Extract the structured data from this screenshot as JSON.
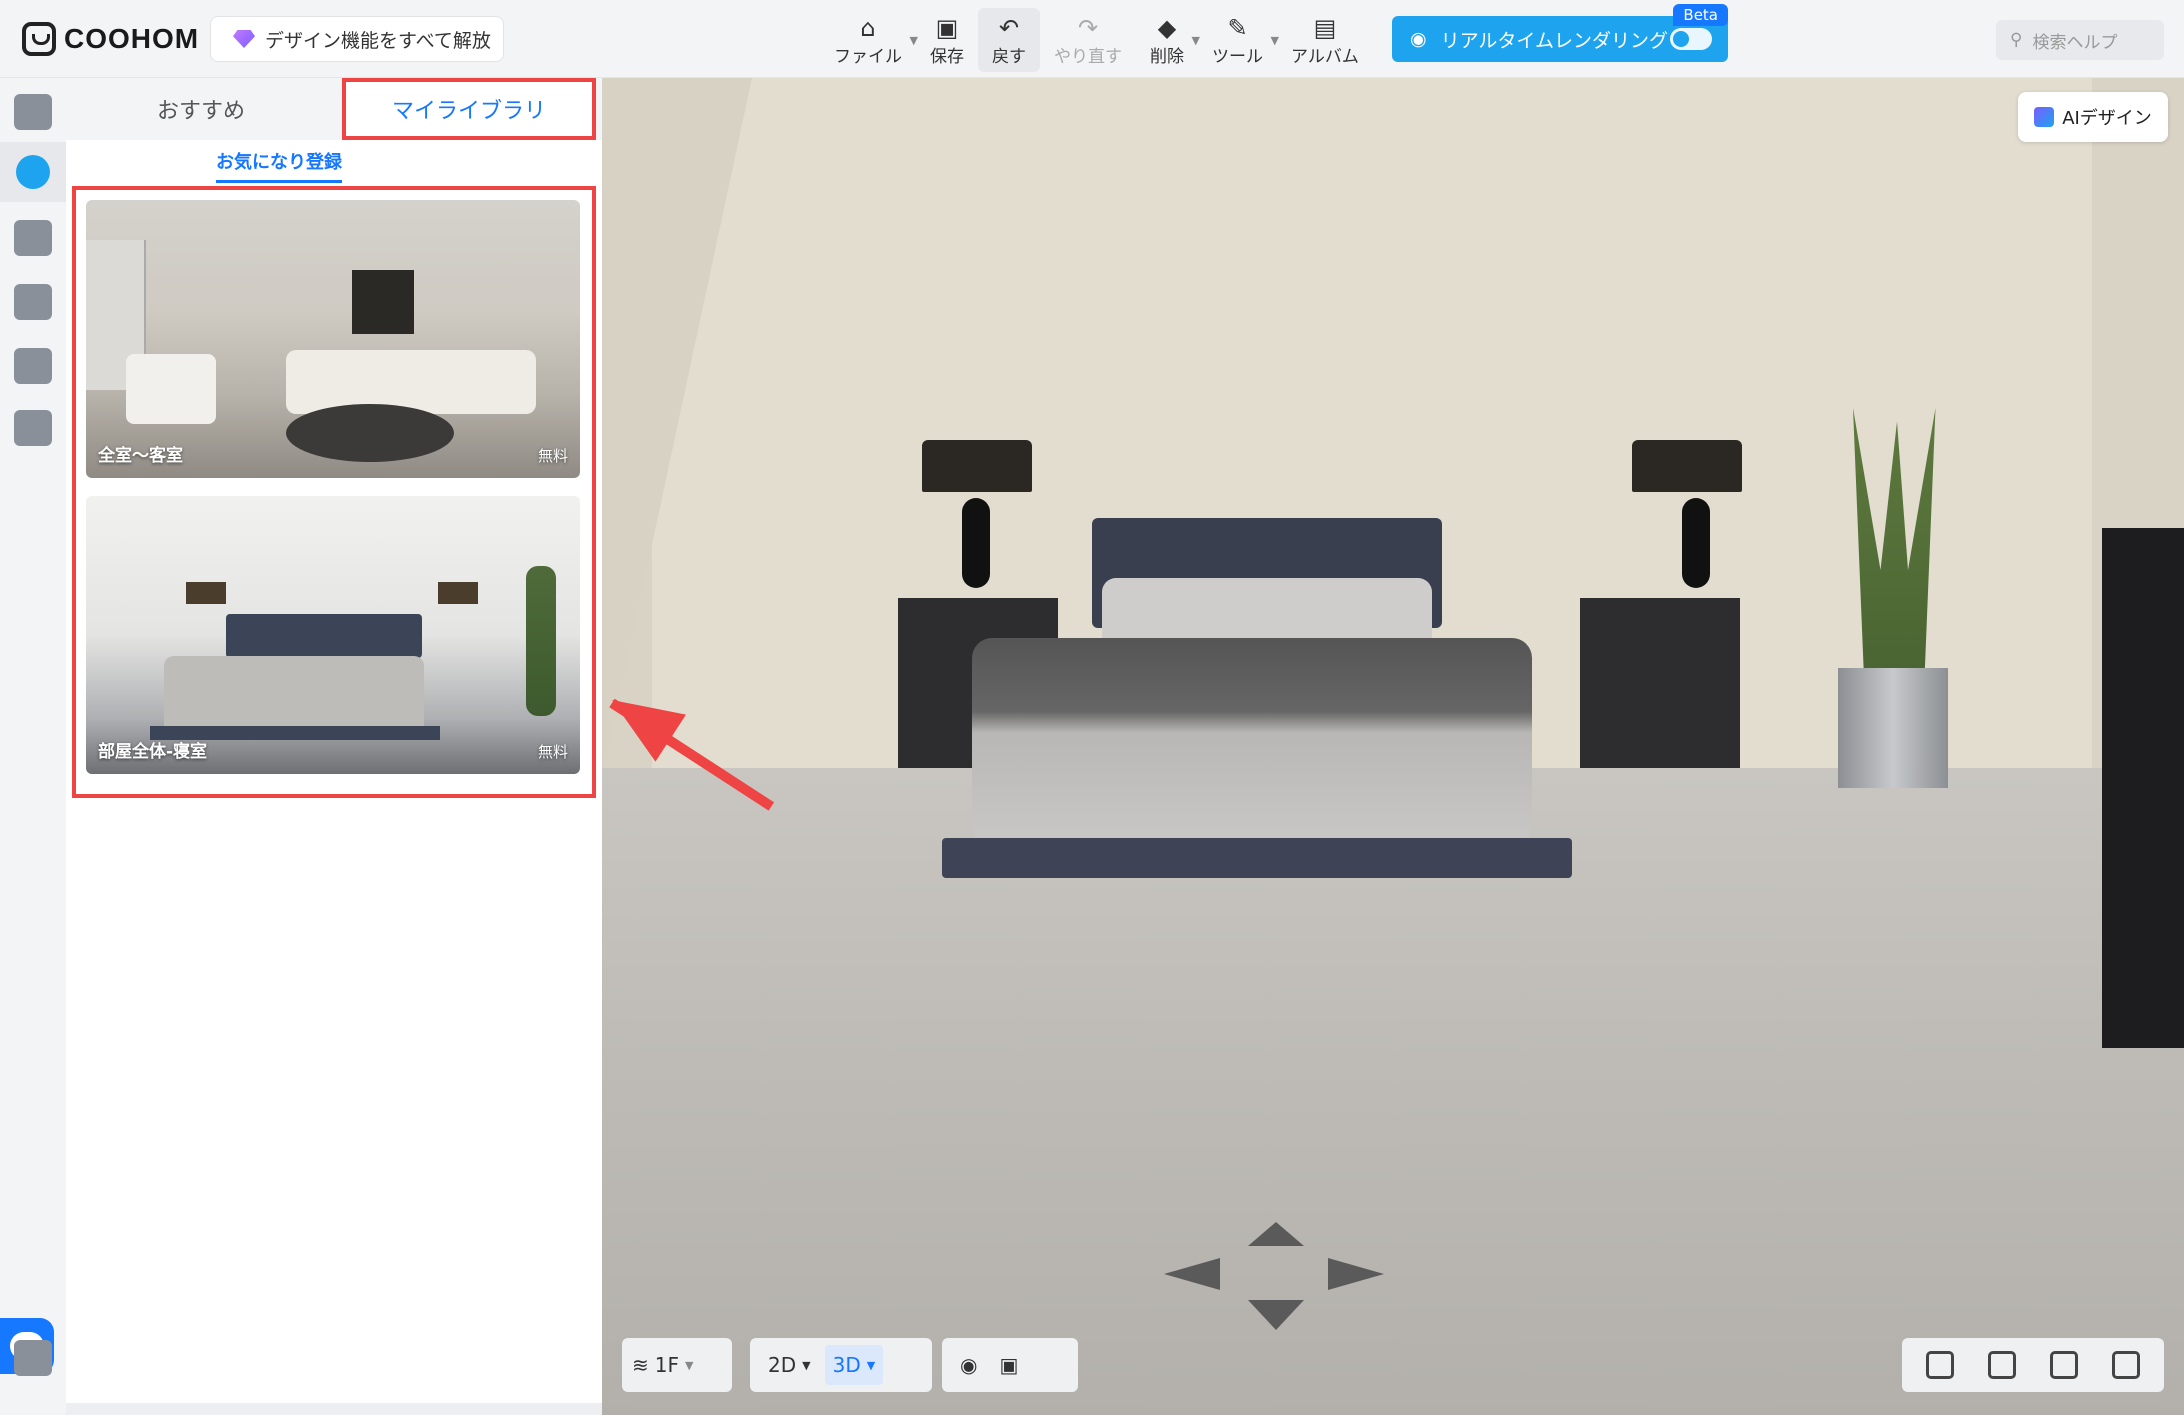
{
  "brand": {
    "logo_text": "COOHOM"
  },
  "header": {
    "unlock_label": "デザイン機能をすべて解放",
    "tools": [
      {
        "label": "ファイル",
        "icon": "file-icon"
      },
      {
        "label": "保存",
        "icon": "save-icon"
      },
      {
        "label": "戻す",
        "icon": "undo-icon"
      },
      {
        "label": "やり直す",
        "icon": "redo-icon"
      },
      {
        "label": "削除",
        "icon": "eraser-icon"
      },
      {
        "label": "ツール",
        "icon": "wrench-icon"
      },
      {
        "label": "アルバム",
        "icon": "album-icon"
      }
    ],
    "realtime_label": "リアルタイムレンダリング",
    "beta_label": "Beta",
    "search_placeholder": "検索ヘルプ"
  },
  "panel": {
    "tab_recommended": "おすすめ",
    "tab_library": "マイライブラリ",
    "subtab": "お気になり登録",
    "cards": [
      {
        "title": "全室〜客室",
        "price": "無料"
      },
      {
        "title": "部屋全体-寝室",
        "price": "無料"
      }
    ]
  },
  "viewport": {
    "ai_label": "AIデザイン"
  },
  "bottom": {
    "floor_label": "1F",
    "view_2d": "2D",
    "view_3d": "3D"
  },
  "colors": {
    "accent": "#1677ff",
    "realtime": "#1ea4ef",
    "highlight": "#ef4444"
  }
}
